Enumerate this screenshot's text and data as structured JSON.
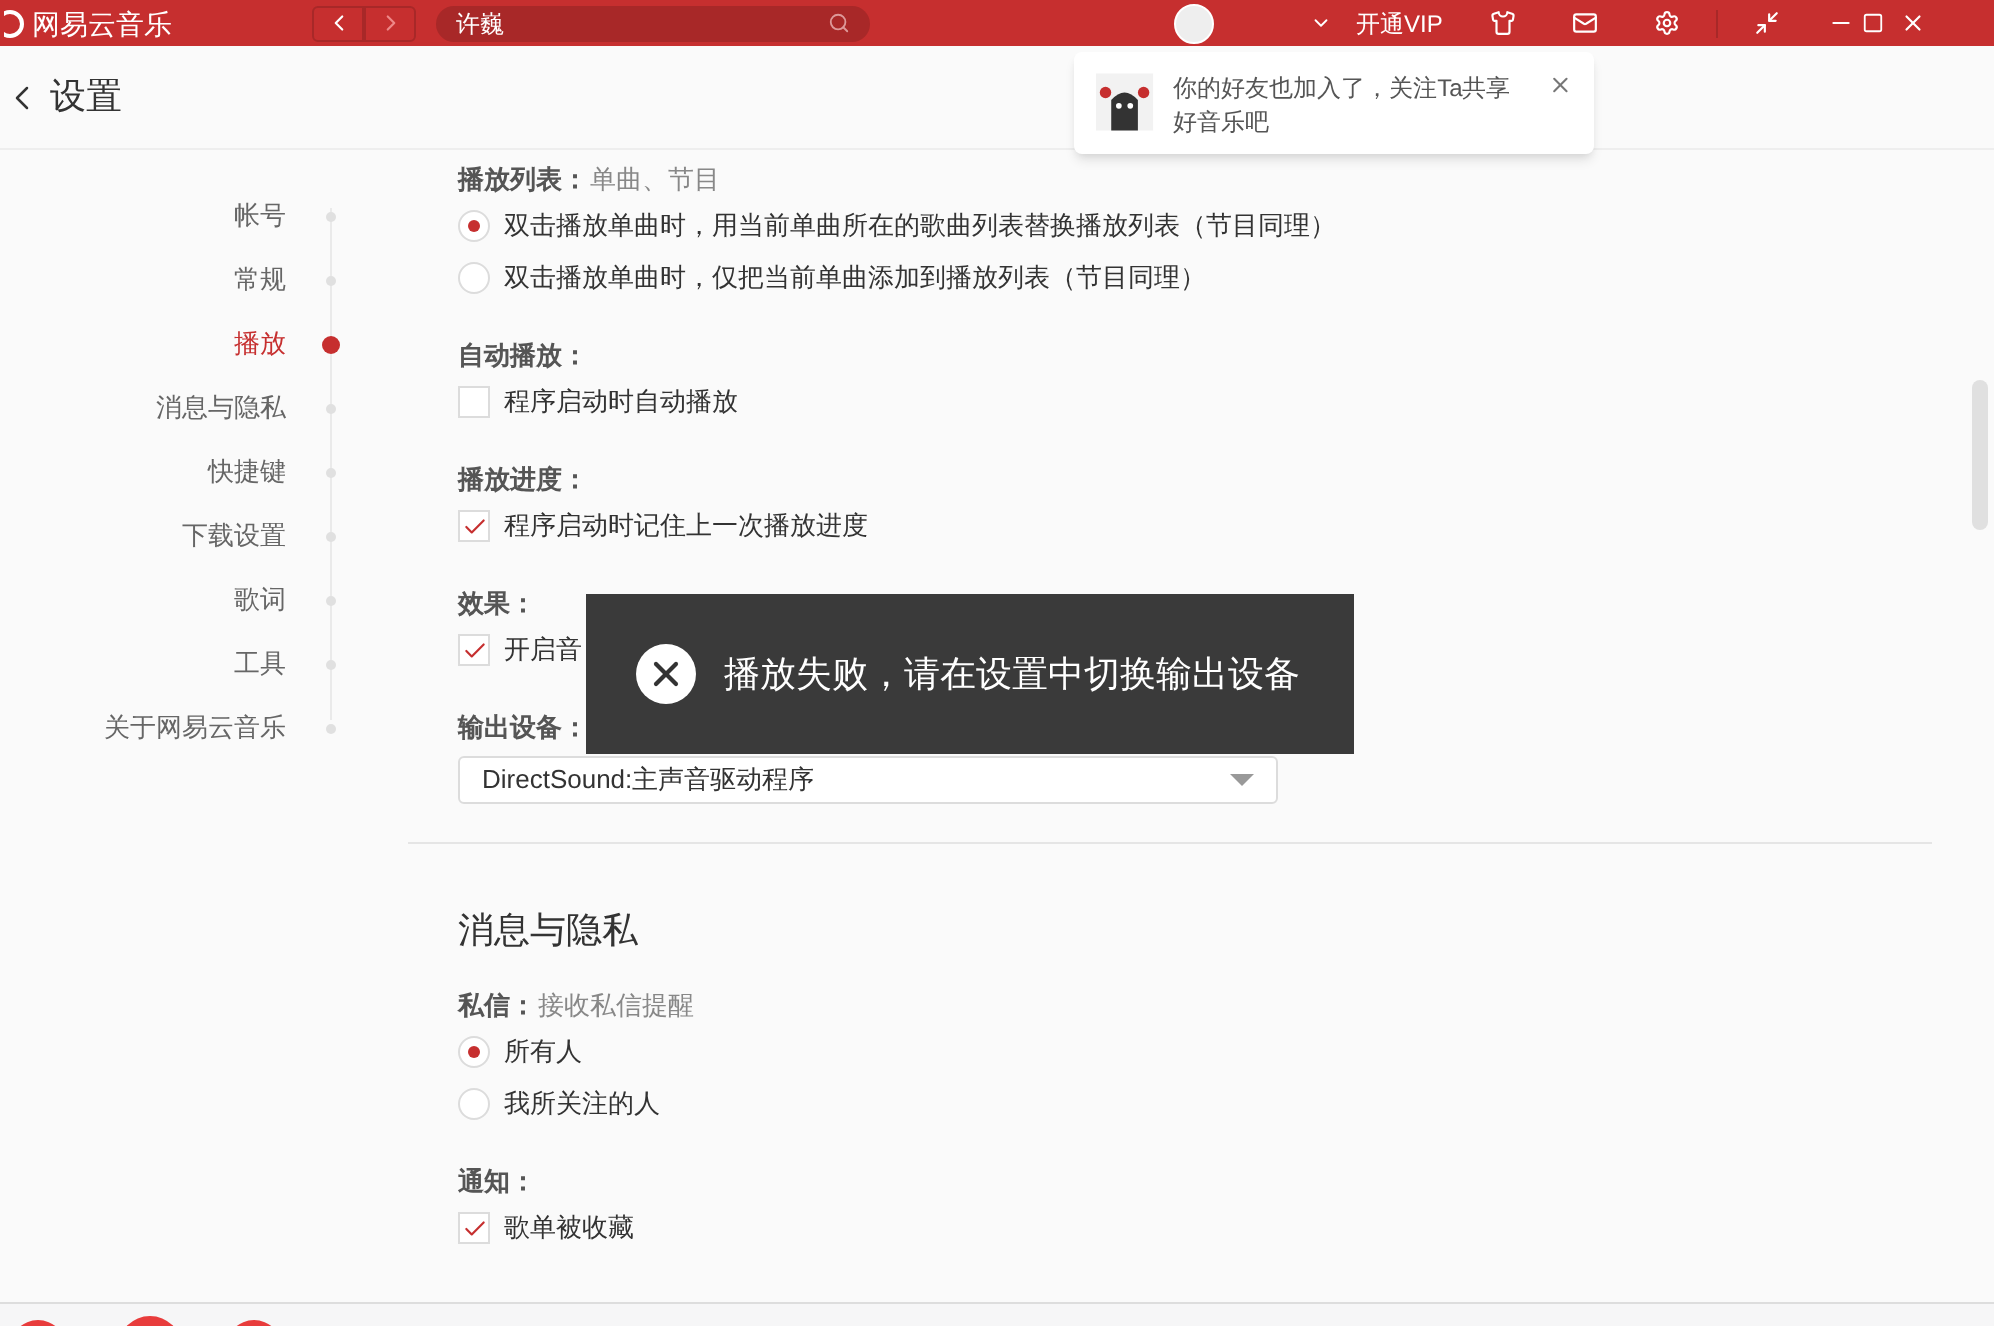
{
  "app": {
    "title": "网易云音乐",
    "search": {
      "value": "许巍"
    },
    "vip": "开通VIP"
  },
  "page": {
    "title": "设置"
  },
  "notification": {
    "text": "你的好友也加入了，关注Ta共享好音乐吧"
  },
  "sidebar": {
    "items": [
      {
        "label": "帐号",
        "selected": false
      },
      {
        "label": "常规",
        "selected": false
      },
      {
        "label": "播放",
        "selected": true
      },
      {
        "label": "消息与隐私",
        "selected": false
      },
      {
        "label": "快捷键",
        "selected": false
      },
      {
        "label": "下载设置",
        "selected": false
      },
      {
        "label": "歌词",
        "selected": false
      },
      {
        "label": "工具",
        "selected": false
      },
      {
        "label": "关于网易云音乐",
        "selected": false
      }
    ]
  },
  "sections": [
    {
      "groups": [
        {
          "label": "播放列表：",
          "hint": "单曲、节目",
          "options": [
            {
              "kind": "radio",
              "label": "双击播放单曲时，用当前单曲所在的歌曲列表替换播放列表（节目同理）",
              "selected": true
            },
            {
              "kind": "radio",
              "label": "双击播放单曲时，仅把当前单曲添加到播放列表（节目同理）",
              "selected": false
            }
          ]
        },
        {
          "label": "自动播放：",
          "options": [
            {
              "kind": "checkbox",
              "label": "程序启动时自动播放",
              "checked": false
            }
          ]
        },
        {
          "label": "播放进度：",
          "options": [
            {
              "kind": "checkbox",
              "label": "程序启动时记住上一次播放进度",
              "checked": true
            }
          ]
        },
        {
          "label": "效果：",
          "options": [
            {
              "kind": "checkbox",
              "label": "开启音",
              "checked": true
            }
          ]
        },
        {
          "label": "输出设备：",
          "options": [
            {
              "kind": "select",
              "value": "DirectSound:主声音驱动程序"
            }
          ]
        }
      ]
    },
    {
      "title": "消息与隐私",
      "groups": [
        {
          "label": "私信：",
          "hint": "接收私信提醒",
          "options": [
            {
              "kind": "radio",
              "label": "所有人",
              "selected": true
            },
            {
              "kind": "radio",
              "label": "我所关注的人",
              "selected": false
            }
          ]
        },
        {
          "label": "通知：",
          "options": [
            {
              "kind": "checkbox",
              "label": "歌单被收藏",
              "checked": true
            }
          ]
        }
      ]
    }
  ],
  "toast": {
    "text": "播放失败，请在设置中切换输出设备"
  }
}
